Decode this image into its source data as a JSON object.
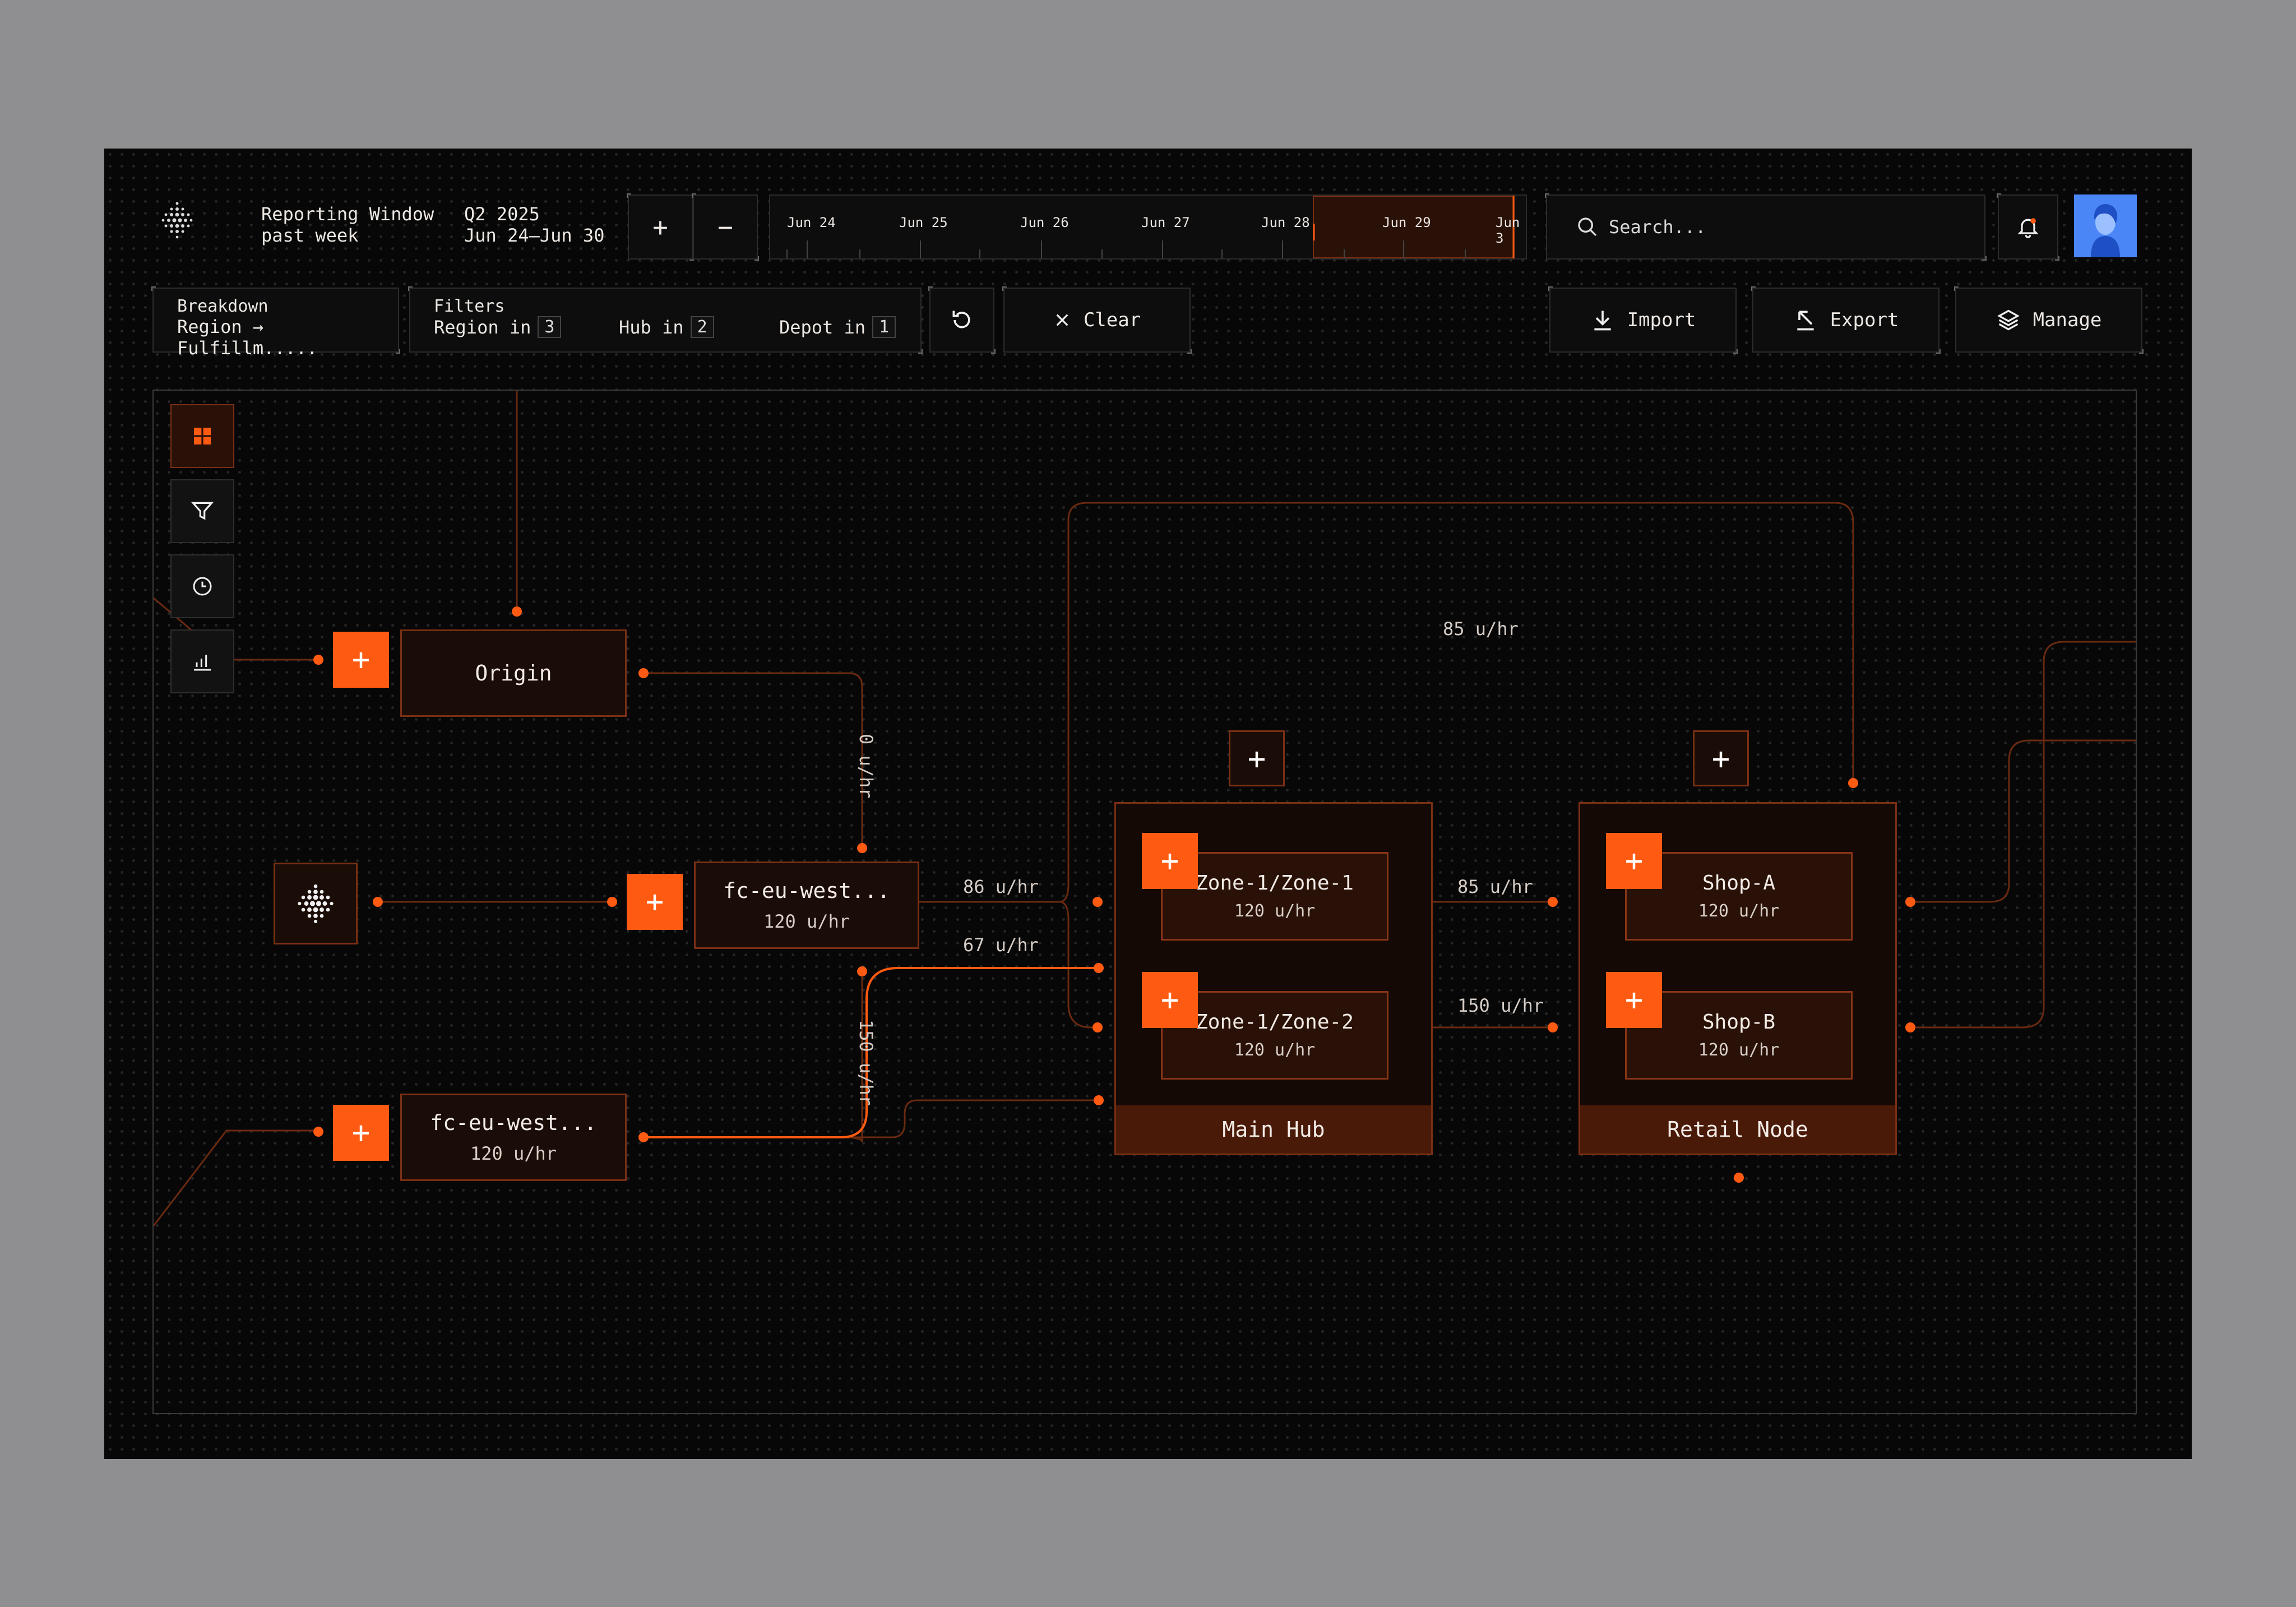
{
  "header": {
    "reporting_title": "Reporting Window",
    "reporting_sub": "past week",
    "period_title": "Q2 2025",
    "period_range": "Jun 24–Jun 30",
    "zoom_in": "+",
    "zoom_out": "−",
    "timeline": [
      "Jun 24",
      "Jun 25",
      "Jun 26",
      "Jun 27",
      "Jun 28",
      "Jun 29",
      "Jun 3"
    ],
    "search_placeholder": "Search...",
    "colors": {
      "accent": "#ff5a12",
      "brand_avatar": "#3f7cf5"
    }
  },
  "toolbar": {
    "breakdown_label": "Breakdown",
    "breakdown_value": "Region → Fulfillm.....",
    "filters_label": "Filters",
    "filters": [
      {
        "label": "Region in",
        "count": "3"
      },
      {
        "label": "Hub in",
        "count": "2"
      },
      {
        "label": "Depot in",
        "count": "1"
      }
    ],
    "clear_label": "Clear",
    "import_label": "Import",
    "export_label": "Export",
    "manage_label": "Manage"
  },
  "side_tools": [
    "grid-icon",
    "filter-icon",
    "clock-icon",
    "chart-icon"
  ],
  "canvas": {
    "origin": {
      "title": "Origin"
    },
    "fc1": {
      "title": "fc-eu-west...",
      "rate": "120 u/hr"
    },
    "fc2": {
      "title": "fc-eu-west...",
      "rate": "120 u/hr"
    },
    "main_hub": {
      "label": "Main Hub",
      "zones": [
        {
          "title": "Zone-1/Zone-1",
          "rate": "120 u/hr"
        },
        {
          "title": "Zone-1/Zone-2",
          "rate": "120 u/hr"
        }
      ]
    },
    "retail_node": {
      "label": "Retail Node",
      "shops": [
        {
          "title": "Shop-A",
          "rate": "120 u/hr"
        },
        {
          "title": "Shop-B",
          "rate": "120 u/hr"
        }
      ]
    },
    "flows": {
      "top": "85 u/hr",
      "origin_fc": "0 u/hr",
      "fc_hub_a": "86 u/hr",
      "fc_hub_b": "67 u/hr",
      "fc_down": "150 u/hr",
      "hub_retail_a": "85 u/hr",
      "hub_retail_b": "150 u/hr"
    }
  }
}
